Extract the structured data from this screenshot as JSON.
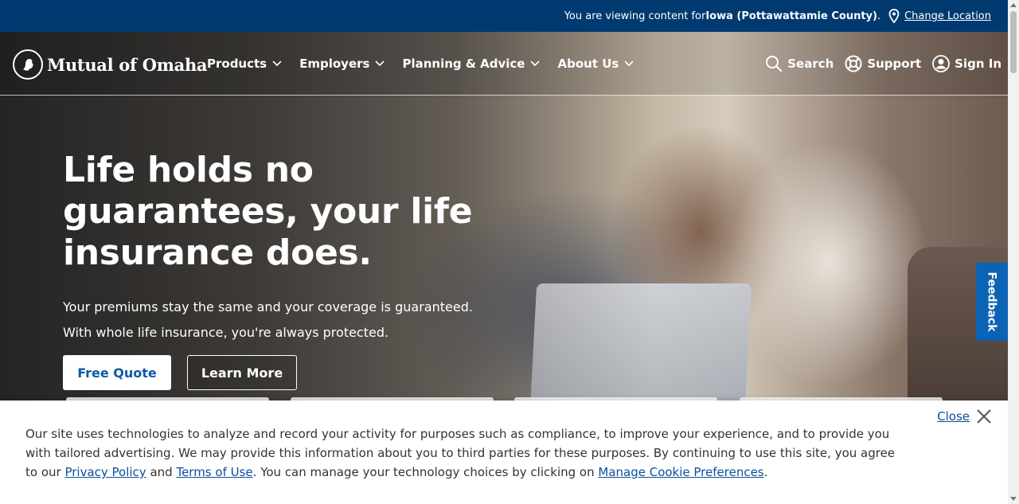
{
  "location_bar": {
    "prefix": "You are viewing content for ",
    "location": "Iowa (Pottawattamie County)",
    "suffix": ".",
    "change_link": "Change Location"
  },
  "header": {
    "logo_text": "Mutual of Omaha",
    "nav": [
      {
        "label": "Products"
      },
      {
        "label": "Employers"
      },
      {
        "label": "Planning & Advice"
      },
      {
        "label": "About Us"
      }
    ],
    "utility": {
      "search": "Search",
      "support": "Support",
      "sign_in": "Sign In"
    }
  },
  "hero": {
    "title": "Life holds no guarantees, your life insurance does.",
    "subtitle_line1": "Your premiums stay the same and your coverage is guaranteed.",
    "subtitle_line2": "With whole life insurance, you're always protected.",
    "primary_button": "Free Quote",
    "secondary_button": "Learn More"
  },
  "feedback_tab": "Feedback",
  "cookie_banner": {
    "close_label": "Close",
    "text_part1": "Our site uses technologies to analyze and record your activity for purposes such as compliance, to improve your experience, and to provide you with tailored advertising. We may provide this information about you to third parties for these purposes. By continuing to use this site, you agree to our ",
    "privacy_link": "Privacy Policy",
    "text_part2": " and ",
    "terms_link": "Terms of Use",
    "text_part3": ". You can manage your technology choices by clicking on ",
    "manage_link": "Manage Cookie Preferences",
    "text_part4": "."
  },
  "colors": {
    "top_bar": "#003a70",
    "link_blue": "#0b4f9c",
    "feedback_blue": "#0b63b5"
  }
}
